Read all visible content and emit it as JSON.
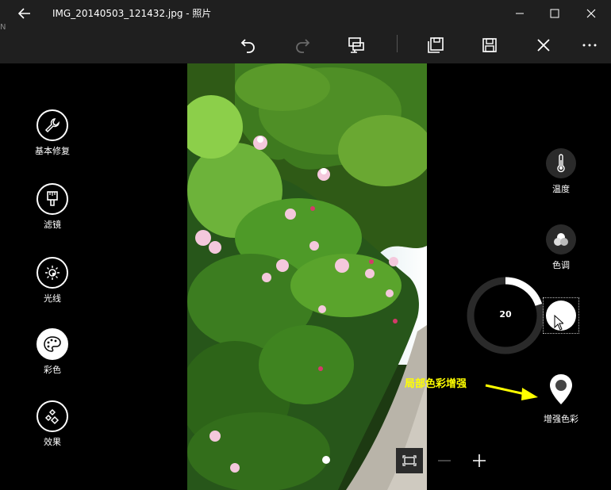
{
  "titlebar": {
    "title": "IMG_20140503_121432.jpg - 照片",
    "icons": [
      "back-arrow-icon",
      "minimize-icon",
      "maximize-icon",
      "close-icon"
    ]
  },
  "toolbar": {
    "icons": [
      "undo-icon",
      "redo-icon",
      "compare-icon",
      "save-copy-icon",
      "save-icon",
      "cancel-icon",
      "more-icon"
    ]
  },
  "left_panel": {
    "categories": [
      {
        "label": "基本修复",
        "icon": "wrench-icon"
      },
      {
        "label": "滤镜",
        "icon": "filter-icon"
      },
      {
        "label": "光线",
        "icon": "sun-icon"
      },
      {
        "label": "彩色",
        "icon": "palette-icon",
        "active": true
      },
      {
        "label": "效果",
        "icon": "effects-icon"
      }
    ]
  },
  "right_panel": {
    "temperature_label": "温度",
    "tint_label": "色调",
    "dial_value": "20",
    "dial_fraction": 0.2,
    "local_color_label": "增强色彩"
  },
  "annotation": {
    "text": "局部色彩增强",
    "color": "#ffff00"
  },
  "zoom_bar": {
    "icons": [
      "fit-screen-icon",
      "zoom-out-icon",
      "zoom-in-icon"
    ]
  }
}
